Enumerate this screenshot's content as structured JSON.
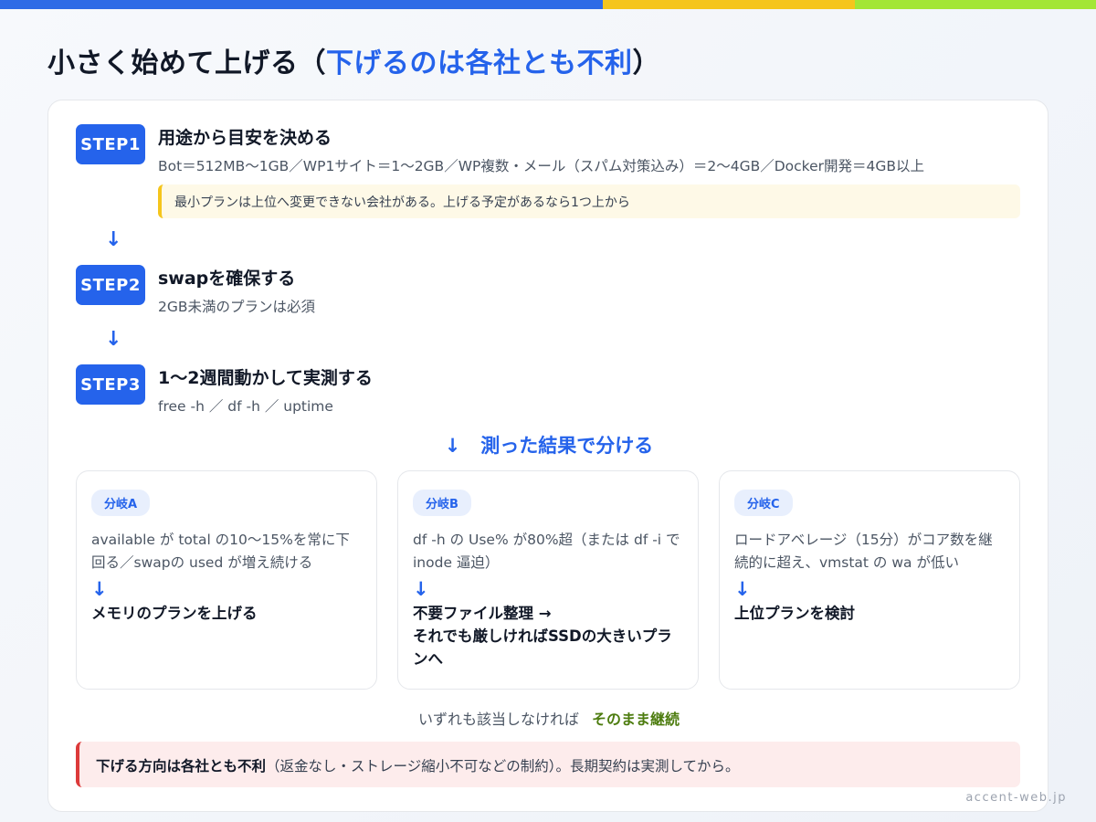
{
  "title": {
    "main": "小さく始めて上げる",
    "paren_open": "（",
    "accent": "下げるのは各社とも不利",
    "paren_close": "）"
  },
  "steps": [
    {
      "badge": "STEP1",
      "title": "用途から目安を決める",
      "desc": "Bot＝512MB〜1GB／WP1サイト＝1〜2GB／WP複数・メール（スパム対策込み）＝2〜4GB／Docker開発＝4GB以上",
      "note": "最小プランは上位へ変更できない会社がある。上げる予定があるなら1つ上から"
    },
    {
      "badge": "STEP2",
      "title": "swapを確保する",
      "desc": "2GB未満のプランは必須"
    },
    {
      "badge": "STEP3",
      "title": "1〜2週間動かして実測する",
      "desc": "free -h ／ df -h ／ uptime"
    }
  ],
  "arrow": "↓",
  "branch_header": "測った結果で分ける",
  "branches": [
    {
      "tag": "分岐A",
      "condition": "available が total の10〜15%を常に下回る／swapの used が増え続ける",
      "result": "メモリのプランを上げる"
    },
    {
      "tag": "分岐B",
      "condition": "df -h の Use% が80%超（または df -i で inode 逼迫）",
      "result": "不要ファイル整理 →\nそれでも厳しければSSDの大きいプランへ"
    },
    {
      "tag": "分岐C",
      "condition": "ロードアベレージ（15分）がコア数を継続的に超え、vmstat の wa が低い",
      "result": "上位プランを検討"
    }
  ],
  "continue": {
    "text": "いずれも該当しなければ",
    "highlight": "そのまま継続"
  },
  "warning": {
    "bold": "下げる方向は各社とも不利",
    "text": "（返金なし・ストレージ縮小不可などの制約）。長期契約は実測してから。"
  },
  "footer": "accent-web.jp",
  "colors": {
    "accent": "#2563eb",
    "yellow": "#f5c51c",
    "green": "#a3e635",
    "continue_green": "#4d7c0f",
    "warning_red": "#dc3a3a"
  }
}
